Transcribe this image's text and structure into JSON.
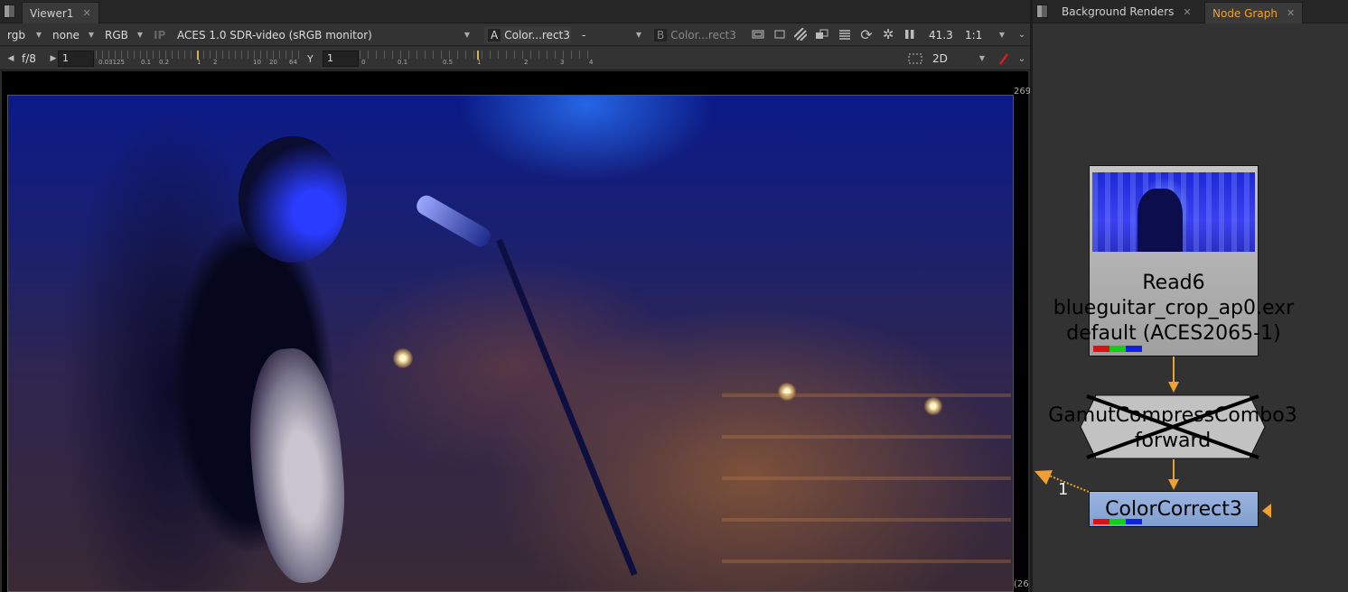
{
  "viewer": {
    "tab_label": "Viewer1",
    "channels": "rgb",
    "alpha_channel": "none",
    "display_channels": "RGB",
    "ip_label": "IP",
    "display_transform": "ACES 1.0 SDR-video (sRGB monitor)",
    "input_a_label": "A",
    "input_a_value": "Color...rect3",
    "compare_mode": "-",
    "input_b_label": "B",
    "input_b_value": "Color...rect3",
    "zoom_percent": "41.3",
    "scale": "1:1",
    "fstop_label": "f/8",
    "gain_value": "1",
    "gain_ticks": [
      "0.03125",
      "0.1",
      "0.2",
      "1",
      "2",
      "10",
      "20",
      "64"
    ],
    "gamma_label": "Y",
    "gamma_value": "1",
    "gamma_ticks": [
      "0",
      "0.1",
      "0.5",
      "1",
      "2",
      "3",
      "4"
    ],
    "view_mode": "2D",
    "coord_top_right": "269",
    "coord_bottom_right": "(26"
  },
  "node_graph": {
    "tabs": [
      {
        "label": "Background Renders",
        "active": false
      },
      {
        "label": "Node Graph",
        "active": true
      }
    ],
    "nodes": [
      {
        "title": "Read6",
        "file": "blueguitar_crop_ap0.exr",
        "colorspace": "default (ACES2065-1)"
      },
      {
        "title": "GamutCompressCombo3",
        "subtitle": "forward",
        "disabled": true
      },
      {
        "title": "ColorCorrect3"
      }
    ],
    "viewer_input_number": "1"
  },
  "colors": {
    "accent": "#f0a030",
    "panel": "#323232",
    "read_node": "#a8a8a8",
    "colorcorrect_node": "#7f9fd0"
  }
}
